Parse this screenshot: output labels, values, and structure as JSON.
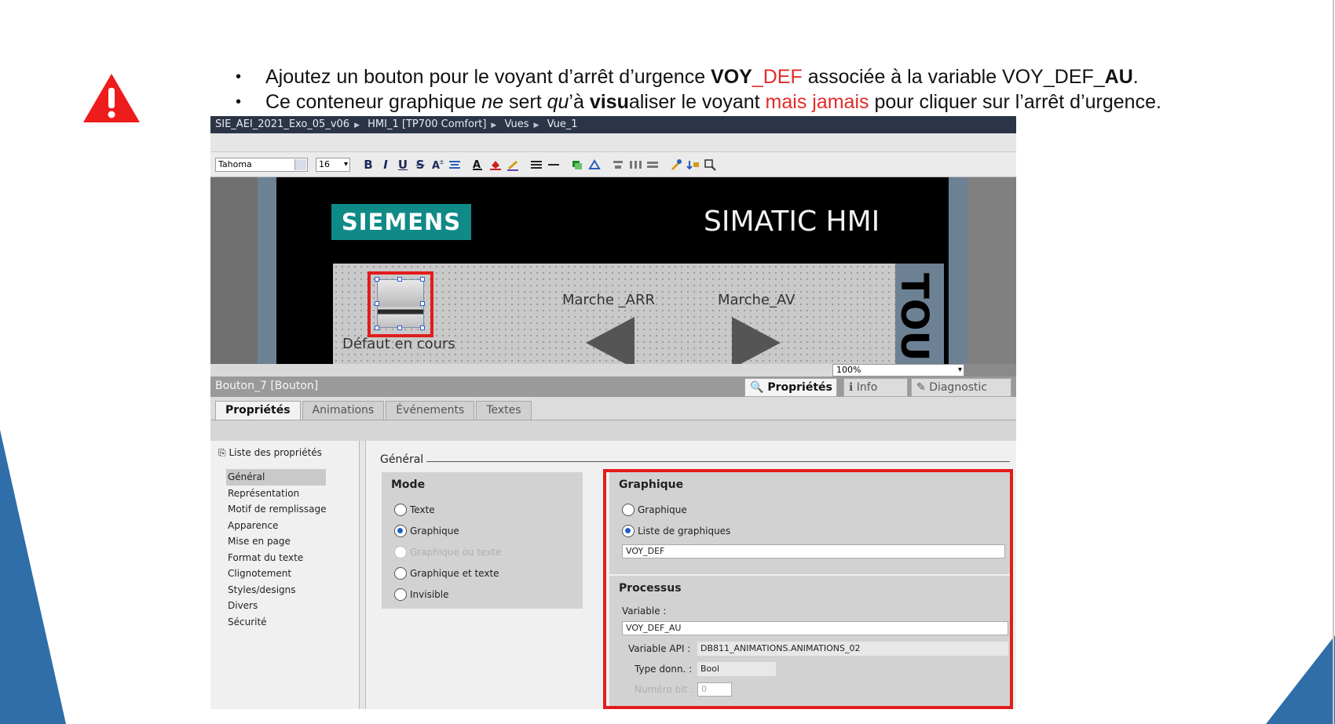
{
  "slide": {
    "bullet1": {
      "t1": "Ajoutez un bouton pour le voyant d’arrêt d’urgence ",
      "voy": "VOY",
      "def": "_DEF",
      "t2": " associée à la variable VOY_DEF_",
      "au": "AU",
      "t3": "."
    },
    "bullet2": {
      "t1": "Ce conteneur graphique ",
      "ne": "ne",
      "t2": " sert ",
      "qu": "qu",
      "t3": "’à ",
      "visu": "visu",
      "t4": "aliser le voyant ",
      "mais": "mais jamais",
      "t5": " pour cliquer sur l’arrêt d’urgence."
    },
    "colors": {
      "accent_red": "#e32a2a",
      "corner_blue": "#2f6ea8",
      "siemens_teal": "#0f8a87"
    }
  },
  "tia": {
    "breadcrumb": [
      "SIE_AEI_2021_Exo_05_v06",
      "HMI_1 [TP700 Comfort]",
      "Vues",
      "Vue_1"
    ],
    "toolbar": {
      "font": "Tahoma",
      "size": "16",
      "bold": "B",
      "italic": "I",
      "underline": "U",
      "strike": "S"
    },
    "hmi": {
      "logo": "SIEMENS",
      "product": "SIMATIC HMI",
      "label_default": "Défaut en cours",
      "label_arr": "Marche _ARR",
      "label_av": "Marche_AV",
      "side_text": "TOU",
      "zoom": "100%"
    },
    "inspector": {
      "object": "Bouton_7 [Bouton]",
      "right_tabs": [
        "Propriétés",
        "Info",
        "Diagnostic"
      ],
      "tabs": [
        "Propriétés",
        "Animations",
        "Événements",
        "Textes"
      ],
      "prop_list_title": "Liste des propriétés",
      "prop_items": [
        "Général",
        "Représentation",
        "Motif de remplissage",
        "Apparence",
        "Mise en page",
        "Format du texte",
        "Clignotement",
        "Styles/designs",
        "Divers",
        "Sécurité"
      ],
      "section_title": "Général",
      "mode": {
        "title": "Mode",
        "options": [
          "Texte",
          "Graphique",
          "Graphique ou texte",
          "Graphique et texte",
          "Invisible"
        ]
      },
      "graphique": {
        "title": "Graphique",
        "options": [
          "Graphique",
          "Liste de graphiques"
        ],
        "list_value": "VOY_DEF"
      },
      "processus": {
        "title": "Processus",
        "variable_label": "Variable :",
        "variable_value": "VOY_DEF_AU",
        "api_label": "Variable API :",
        "api_value": "DB811_ANIMATIONS.ANIMATIONS_02",
        "type_label": "Type donn. :",
        "type_value": "Bool",
        "bit_label": "Numéro bit :",
        "bit_value": "0"
      }
    }
  }
}
